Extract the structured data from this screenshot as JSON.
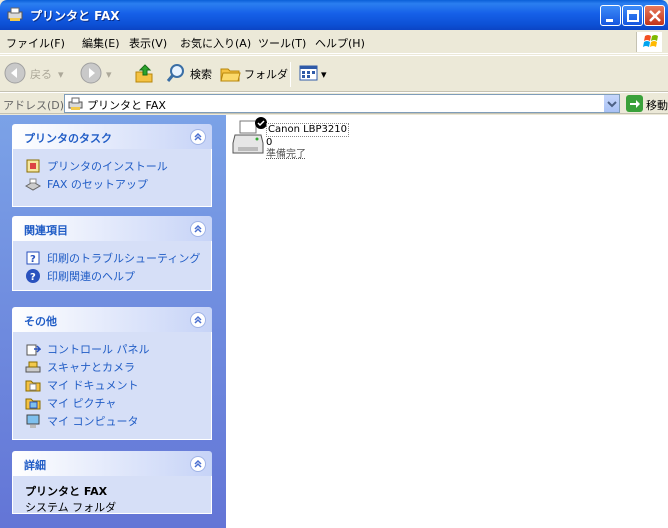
{
  "window": {
    "title": "プリンタと FAX"
  },
  "menu": [
    "ファイル(F)",
    "編集(E)",
    "表示(V)",
    "お気に入り(A)",
    "ツール(T)",
    "ヘルプ(H)"
  ],
  "toolbar": {
    "back": "戻る",
    "search": "検索",
    "folders": "フォルダ"
  },
  "address": {
    "label": "アドレス(D)",
    "value": "プリンタと FAX",
    "go": "移動"
  },
  "panels": {
    "printer_tasks": {
      "title": "プリンタのタスク",
      "items": [
        "プリンタのインストール",
        "FAX のセットアップ"
      ]
    },
    "related": {
      "title": "関連項目",
      "items": [
        "印刷のトラブルシューティング",
        "印刷関連のヘルプ"
      ]
    },
    "other": {
      "title": "その他",
      "items": [
        "コントロール パネル",
        "スキャナとカメラ",
        "マイ ドキュメント",
        "マイ ピクチャ",
        "マイ コンピュータ"
      ]
    },
    "details": {
      "title": "詳細",
      "name": "プリンタと FAX",
      "type": "システム フォルダ"
    }
  },
  "printer": {
    "name": "Canon LBP3210",
    "count": "0",
    "status": "準備完了"
  }
}
